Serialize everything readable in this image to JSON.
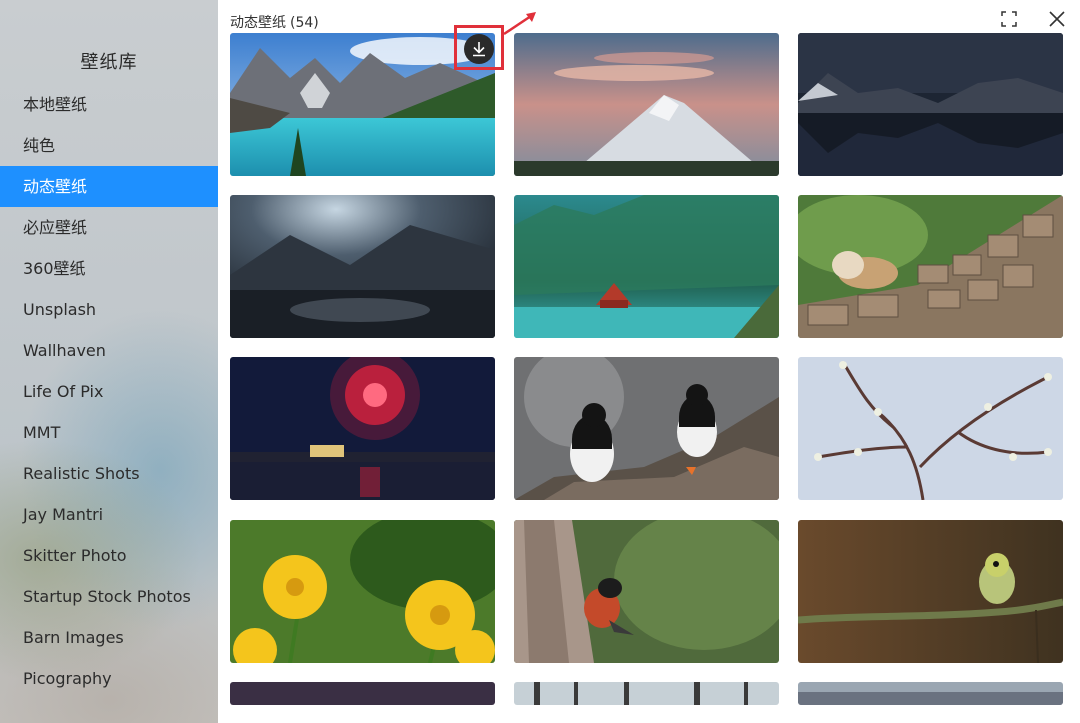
{
  "sidebar": {
    "title": "壁纸库",
    "items": [
      {
        "label": "本地壁纸",
        "active": false
      },
      {
        "label": "纯色",
        "active": false
      },
      {
        "label": "动态壁纸",
        "active": true
      },
      {
        "label": "必应壁纸",
        "active": false
      },
      {
        "label": "360壁纸",
        "active": false
      },
      {
        "label": "Unsplash",
        "active": false
      },
      {
        "label": "Wallhaven",
        "active": false
      },
      {
        "label": "Life Of Pix",
        "active": false
      },
      {
        "label": "MMT",
        "active": false
      },
      {
        "label": "Realistic Shots",
        "active": false
      },
      {
        "label": "Jay Mantri",
        "active": false
      },
      {
        "label": "Skitter Photo",
        "active": false
      },
      {
        "label": "Startup Stock Photos",
        "active": false
      },
      {
        "label": "Barn Images",
        "active": false
      },
      {
        "label": "Picography",
        "active": false
      }
    ]
  },
  "header": {
    "title": "动态壁纸",
    "count": "(54)",
    "icons": [
      "fullscreen-icon",
      "close-icon"
    ]
  },
  "colors": {
    "accent": "#1e90ff",
    "annotation": "#e0303a"
  },
  "thumbnails": [
    "mountain-lake",
    "mountain-sunset-clouds",
    "night-mountain-lake",
    "stormy-coast",
    "red-cabin-lake",
    "owl-stone-wall",
    "fireworks-city",
    "puffins-rock",
    "blossom-branch",
    "yellow-flowers",
    "bullfinch-tree",
    "yellow-bird-branch",
    "partial-1",
    "partial-2",
    "partial-3"
  ]
}
